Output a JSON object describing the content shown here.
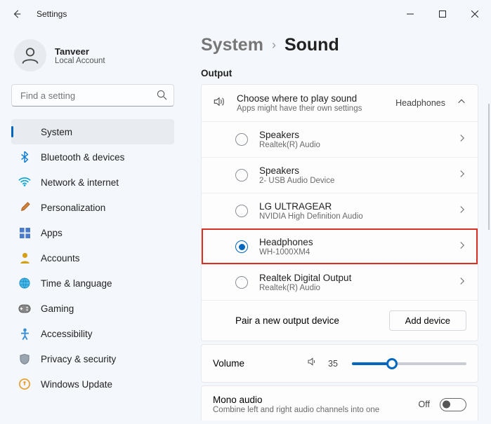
{
  "window": {
    "title": "Settings"
  },
  "user": {
    "name": "Tanveer",
    "sub": "Local Account"
  },
  "search": {
    "placeholder": "Find a setting"
  },
  "nav": [
    {
      "key": "system",
      "label": "System",
      "icon": "💻",
      "active": true
    },
    {
      "key": "bluetooth",
      "label": "Bluetooth & devices",
      "icon": "bt"
    },
    {
      "key": "network",
      "label": "Network & internet",
      "icon": "wifi"
    },
    {
      "key": "personalization",
      "label": "Personalization",
      "icon": "brush"
    },
    {
      "key": "apps",
      "label": "Apps",
      "icon": "apps"
    },
    {
      "key": "accounts",
      "label": "Accounts",
      "icon": "person"
    },
    {
      "key": "time",
      "label": "Time & language",
      "icon": "globe"
    },
    {
      "key": "gaming",
      "label": "Gaming",
      "icon": "game"
    },
    {
      "key": "accessibility",
      "label": "Accessibility",
      "icon": "access"
    },
    {
      "key": "privacy",
      "label": "Privacy & security",
      "icon": "shield"
    },
    {
      "key": "update",
      "label": "Windows Update",
      "icon": "update"
    }
  ],
  "breadcrumb": {
    "parent": "System",
    "current": "Sound"
  },
  "section": {
    "output": "Output"
  },
  "output_header": {
    "title": "Choose where to play sound",
    "sub": "Apps might have their own settings",
    "value": "Headphones"
  },
  "devices": [
    {
      "title": "Speakers",
      "sub": "Realtek(R) Audio",
      "selected": false,
      "highlight": false
    },
    {
      "title": "Speakers",
      "sub": "2- USB Audio Device",
      "selected": false,
      "highlight": false
    },
    {
      "title": "LG ULTRAGEAR",
      "sub": "NVIDIA High Definition Audio",
      "selected": false,
      "highlight": false
    },
    {
      "title": "Headphones",
      "sub": "WH-1000XM4",
      "selected": true,
      "highlight": true
    },
    {
      "title": "Realtek Digital Output",
      "sub": "Realtek(R) Audio",
      "selected": false,
      "highlight": false
    }
  ],
  "pair": {
    "label": "Pair a new output device",
    "button": "Add device"
  },
  "volume": {
    "label": "Volume",
    "value": 35
  },
  "mono": {
    "title": "Mono audio",
    "sub": "Combine left and right audio channels into one",
    "state": "Off"
  }
}
